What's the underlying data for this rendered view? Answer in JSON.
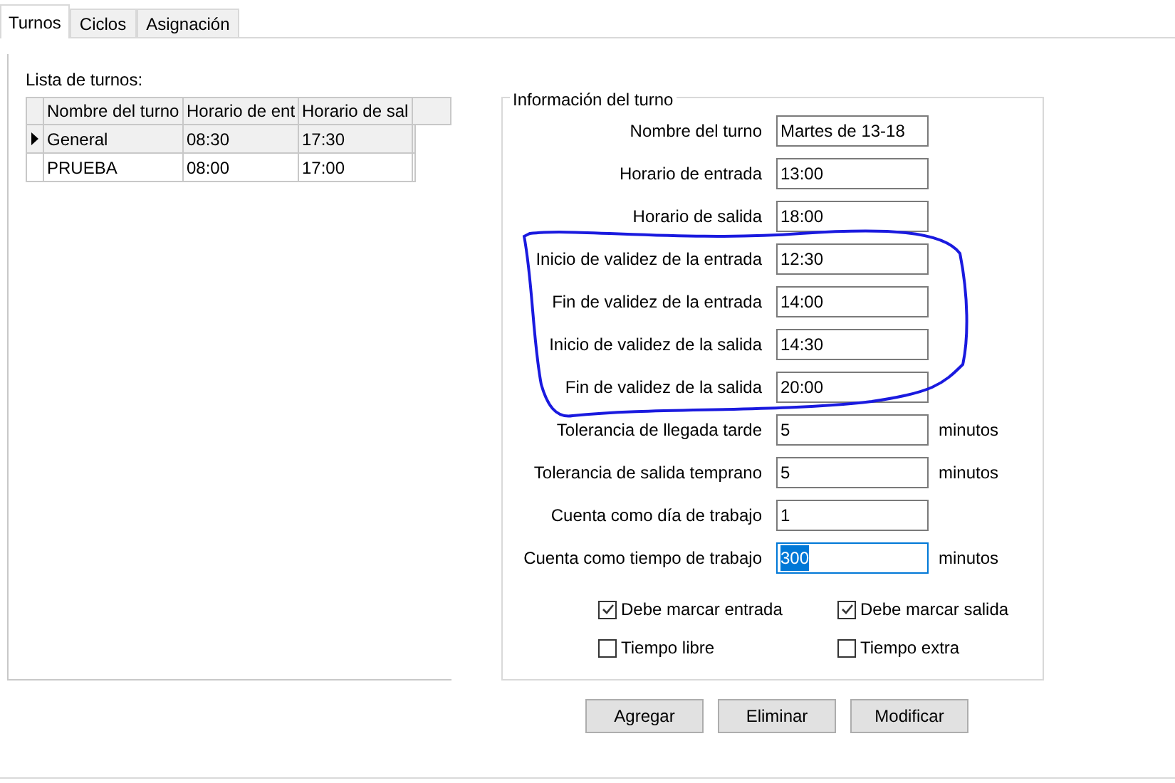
{
  "tabs": [
    {
      "label": "Turnos",
      "selected": true
    },
    {
      "label": "Ciclos",
      "selected": false
    },
    {
      "label": "Asignación",
      "selected": false
    }
  ],
  "shift_list": {
    "label": "Lista de turnos:",
    "columns": [
      "Nombre del turno",
      "Horario de ent",
      "Horario de sal"
    ],
    "rows": [
      {
        "cells": [
          "General",
          "08:30",
          "17:30"
        ],
        "selected": true
      },
      {
        "cells": [
          "PRUEBA",
          "08:00",
          "17:00"
        ],
        "selected": false
      }
    ]
  },
  "shift_info": {
    "title": "Información del turno",
    "fields": [
      {
        "label": "Nombre del turno",
        "value": "Martes de 13-18",
        "focused": false
      },
      {
        "label": "Horario de entrada",
        "value": "13:00",
        "focused": false
      },
      {
        "label": "Horario de salida",
        "value": "18:00",
        "focused": false
      },
      {
        "label": "Inicio de validez de la entrada",
        "value": "12:30",
        "focused": false
      },
      {
        "label": "Fin de validez de la entrada",
        "value": "14:00",
        "focused": false
      },
      {
        "label": "Inicio de validez de la salida",
        "value": "14:30",
        "focused": false
      },
      {
        "label": "Fin de validez de la salida",
        "value": "20:00",
        "focused": false
      },
      {
        "label": "Tolerancia de llegada tarde",
        "value": "5",
        "unit": "minutos",
        "focused": false
      },
      {
        "label": "Tolerancia de salida temprano",
        "value": "5",
        "unit": "minutos",
        "focused": false
      },
      {
        "label": "Cuenta como día de trabajo",
        "value": "1",
        "focused": false
      },
      {
        "label": "Cuenta como tiempo de trabajo",
        "value": "300",
        "unit": "minutos",
        "focused": true
      }
    ],
    "checkboxes": [
      {
        "label": "Debe marcar entrada",
        "checked": true
      },
      {
        "label": "Debe marcar salida",
        "checked": true
      },
      {
        "label": "Tiempo libre",
        "checked": false
      },
      {
        "label": "Tiempo extra",
        "checked": false
      }
    ]
  },
  "buttons": [
    "Agregar",
    "Eliminar",
    "Modificar"
  ]
}
